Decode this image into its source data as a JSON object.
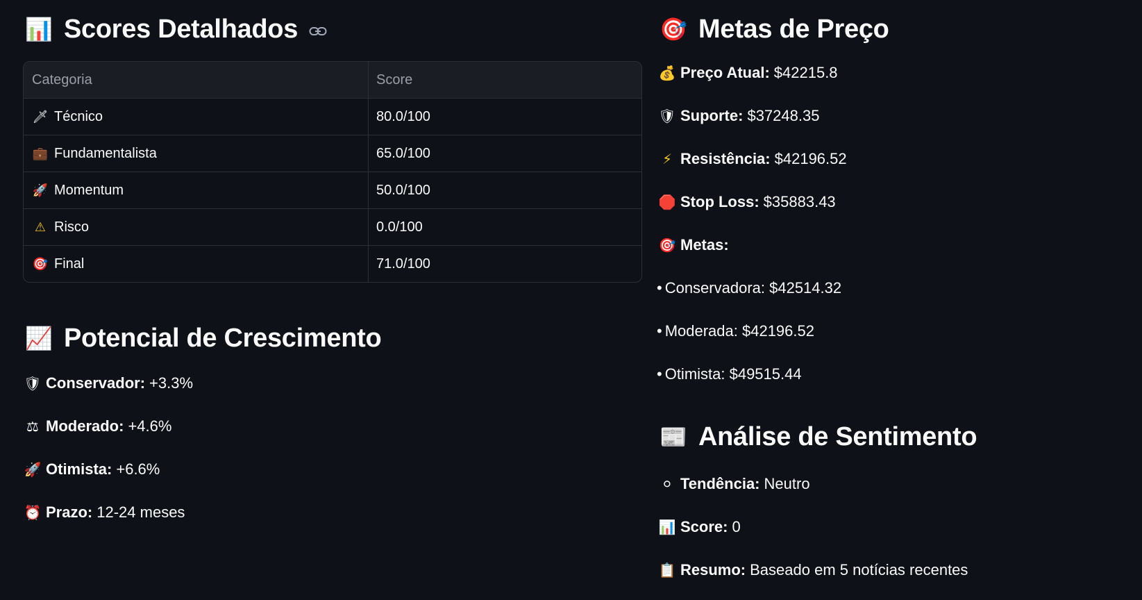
{
  "scores": {
    "heading_emoji": "📊",
    "title": "Scores Detalhados",
    "link_icon": "link-icon",
    "columns": [
      "Categoria",
      "Score"
    ],
    "rows": [
      {
        "emoji": "🗡",
        "category": "Técnico",
        "score": "80.0/100"
      },
      {
        "emoji": "💼",
        "category": "Fundamentalista",
        "score": "65.0/100"
      },
      {
        "emoji": "🚀",
        "category": "Momentum",
        "score": "50.0/100"
      },
      {
        "emoji": "⚠",
        "category": "Risco",
        "score": "0.0/100"
      },
      {
        "emoji": "🎯",
        "category": "Final",
        "score": "71.0/100"
      }
    ]
  },
  "growth": {
    "heading_emoji": "📈",
    "title": "Potencial de Crescimento",
    "items": [
      {
        "emoji": "🛡",
        "label": "Conservador:",
        "value": "+3.3%"
      },
      {
        "emoji": "⚖",
        "label": "Moderado:",
        "value": "+4.6%"
      },
      {
        "emoji": "🚀",
        "label": "Otimista:",
        "value": "+6.6%"
      },
      {
        "emoji": "⏰",
        "label": "Prazo:",
        "value": "12-24 meses"
      }
    ]
  },
  "targets": {
    "heading_emoji": "🎯",
    "title": "Metas de Preço",
    "items": [
      {
        "emoji": "💰",
        "label": "Preço Atual:",
        "value": "$42215.8"
      },
      {
        "emoji": "🛡",
        "label": "Suporte:",
        "value": "$37248.35"
      },
      {
        "emoji": "⚡",
        "label": "Resistência:",
        "value": "$42196.52"
      },
      {
        "emoji": "🛑",
        "label": "Stop Loss:",
        "value": "$35883.43"
      },
      {
        "emoji": "🎯",
        "label": "Metas:",
        "value": ""
      }
    ],
    "goals": [
      {
        "text": "Conservadora: $42514.32"
      },
      {
        "text": "Moderada: $42196.52"
      },
      {
        "text": "Otimista: $49515.44"
      }
    ],
    "bullet": "•"
  },
  "sentiment": {
    "heading_emoji": "📰",
    "title": "Análise de Sentimento",
    "items": [
      {
        "emoji": "⚪",
        "label": "Tendência:",
        "value": "Neutro"
      },
      {
        "emoji": "📊",
        "label": "Score:",
        "value": "0"
      },
      {
        "emoji": "📋",
        "label": "Resumo:",
        "value": "Baseado em 5 notícias recentes"
      }
    ]
  }
}
